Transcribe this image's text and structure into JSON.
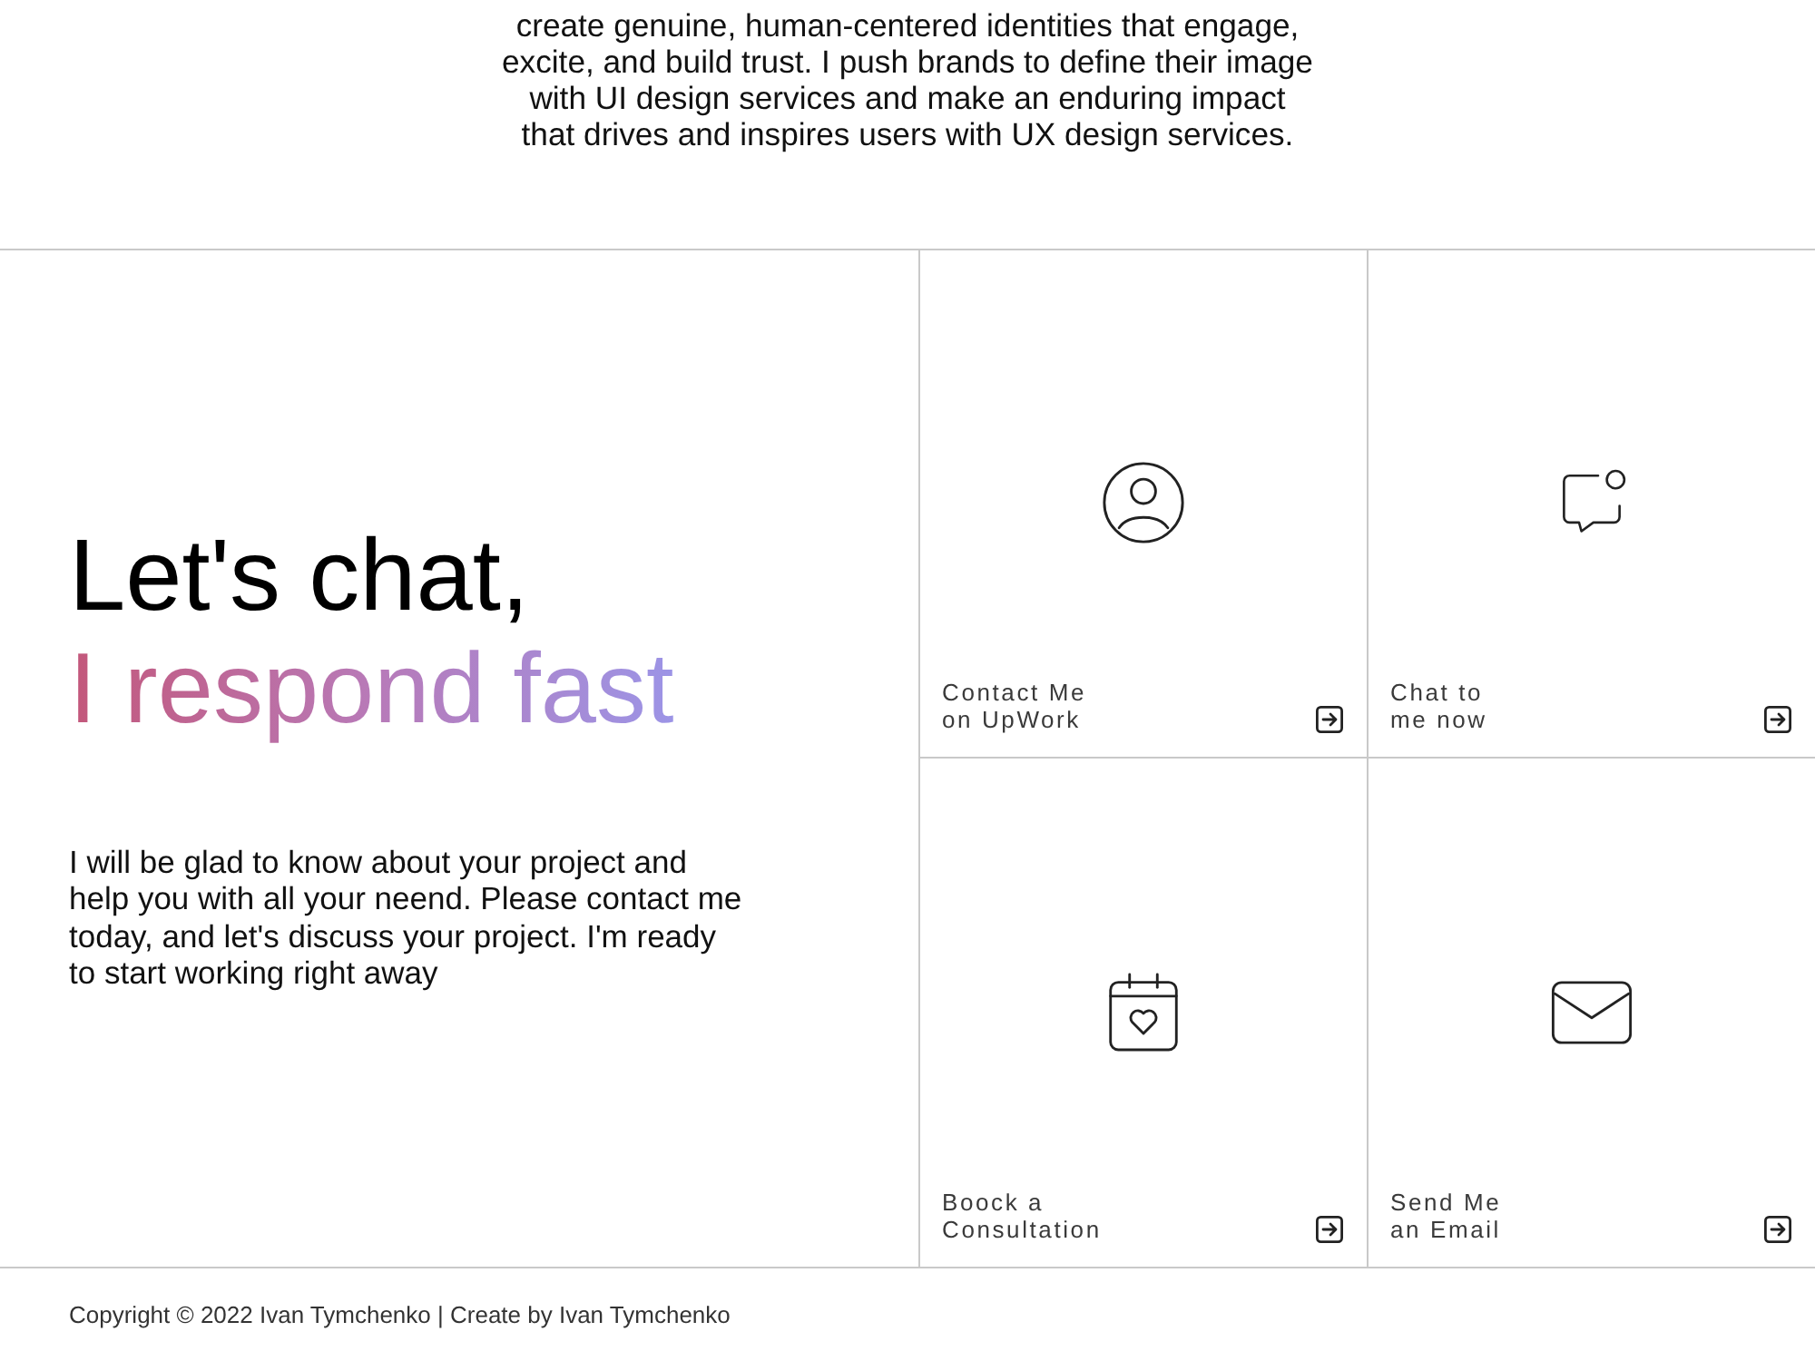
{
  "intro": {
    "text": "create genuine, human-centered identities that engage,\nexcite, and build trust. I push brands to define their image\nwith UI design services and make an enduring impact\nthat drives and inspires users with UX design services."
  },
  "contact": {
    "title": "Let's chat,",
    "subtitle": "I respond fast",
    "text": "I will be glad to know about your project and\nhelp you with all your neend. Please contact me\ntoday, and let's discuss your project. I'm ready\nto start working right away"
  },
  "tiles": [
    {
      "kind": "profile",
      "label": "Contact Me\non UpWork"
    },
    {
      "kind": "chat",
      "label": "Chat to\nme now"
    },
    {
      "kind": "calendar",
      "label": "Boock a\nConsultation"
    },
    {
      "kind": "email",
      "label": "Send Me\nan Email"
    }
  ],
  "footer": {
    "text": "Copyright © 2022 Ivan Tymchenko | Create by Ivan Tymchenko"
  }
}
